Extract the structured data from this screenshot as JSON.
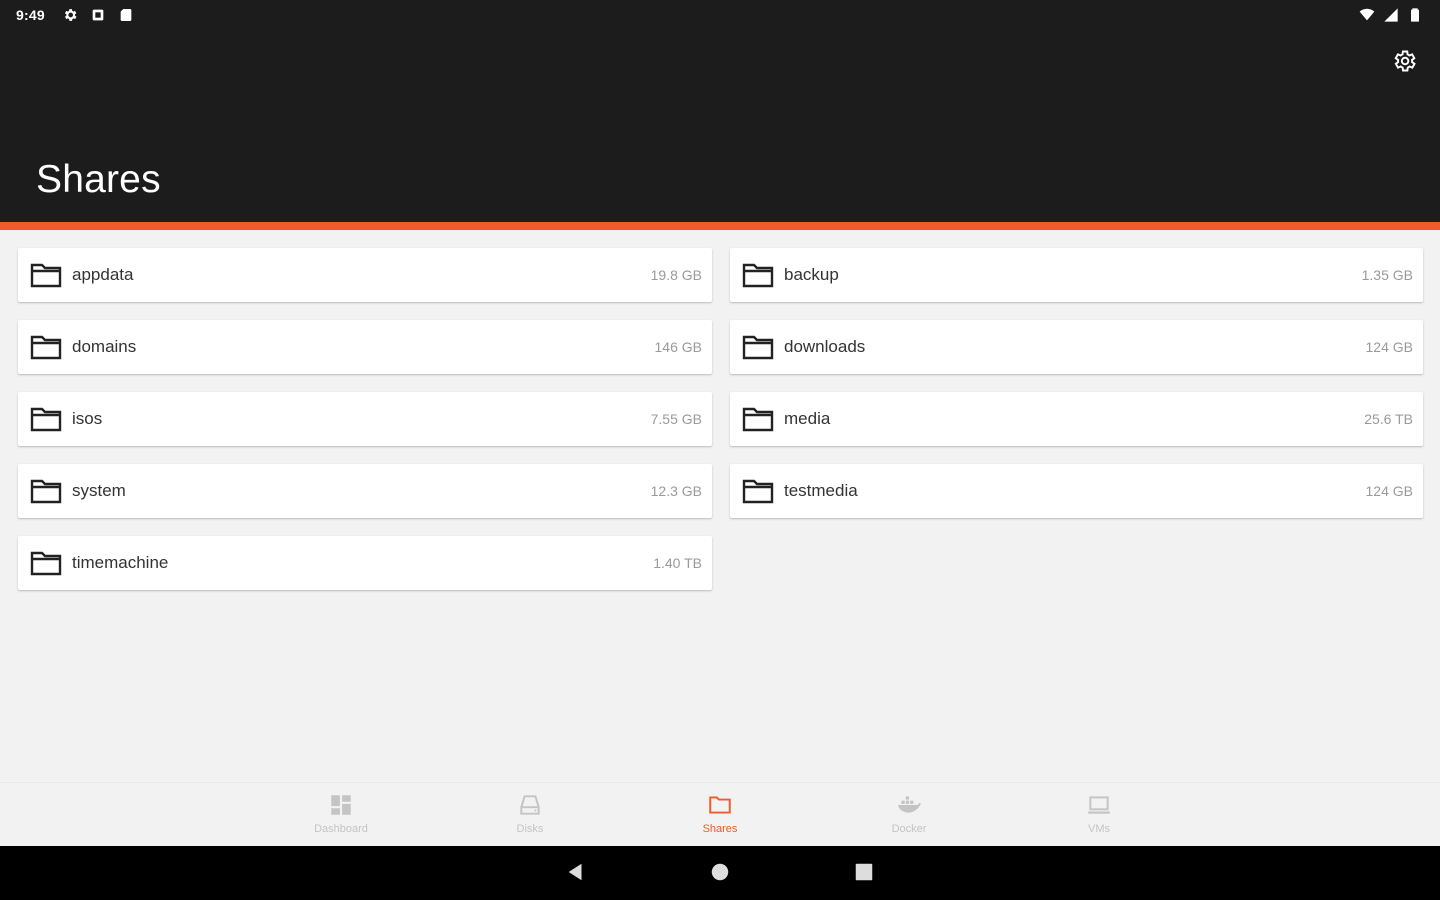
{
  "status_bar": {
    "time": "9:49",
    "left_icons": [
      "gear-icon",
      "notification-icon",
      "sd-card-icon"
    ],
    "right_icons": [
      "wifi-icon",
      "cell-signal-icon",
      "battery-icon"
    ]
  },
  "header": {
    "title": "Shares",
    "settings_icon": "settings-icon",
    "background": "#1c1c1c",
    "accent": "#f15a2b"
  },
  "shares": [
    {
      "name": "appdata",
      "size": "19.8 GB"
    },
    {
      "name": "backup",
      "size": "1.35 GB"
    },
    {
      "name": "domains",
      "size": "146 GB"
    },
    {
      "name": "downloads",
      "size": "124 GB"
    },
    {
      "name": "isos",
      "size": "7.55 GB"
    },
    {
      "name": "media",
      "size": "25.6 TB"
    },
    {
      "name": "system",
      "size": "12.3 GB"
    },
    {
      "name": "testmedia",
      "size": "124 GB"
    },
    {
      "name": "timemachine",
      "size": "1.40 TB"
    }
  ],
  "bottom_nav": {
    "items": [
      {
        "label": "Dashboard",
        "icon": "dashboard-icon",
        "active": false
      },
      {
        "label": "Disks",
        "icon": "disk-icon",
        "active": false
      },
      {
        "label": "Shares",
        "icon": "folder-icon",
        "active": true
      },
      {
        "label": "Docker",
        "icon": "docker-icon",
        "active": false
      },
      {
        "label": "VMs",
        "icon": "laptop-icon",
        "active": false
      }
    ],
    "active_color": "#f15a2b",
    "inactive_color": "#c4c4c4"
  },
  "system_nav": {
    "buttons": [
      "back-icon",
      "home-icon",
      "recents-icon"
    ]
  }
}
